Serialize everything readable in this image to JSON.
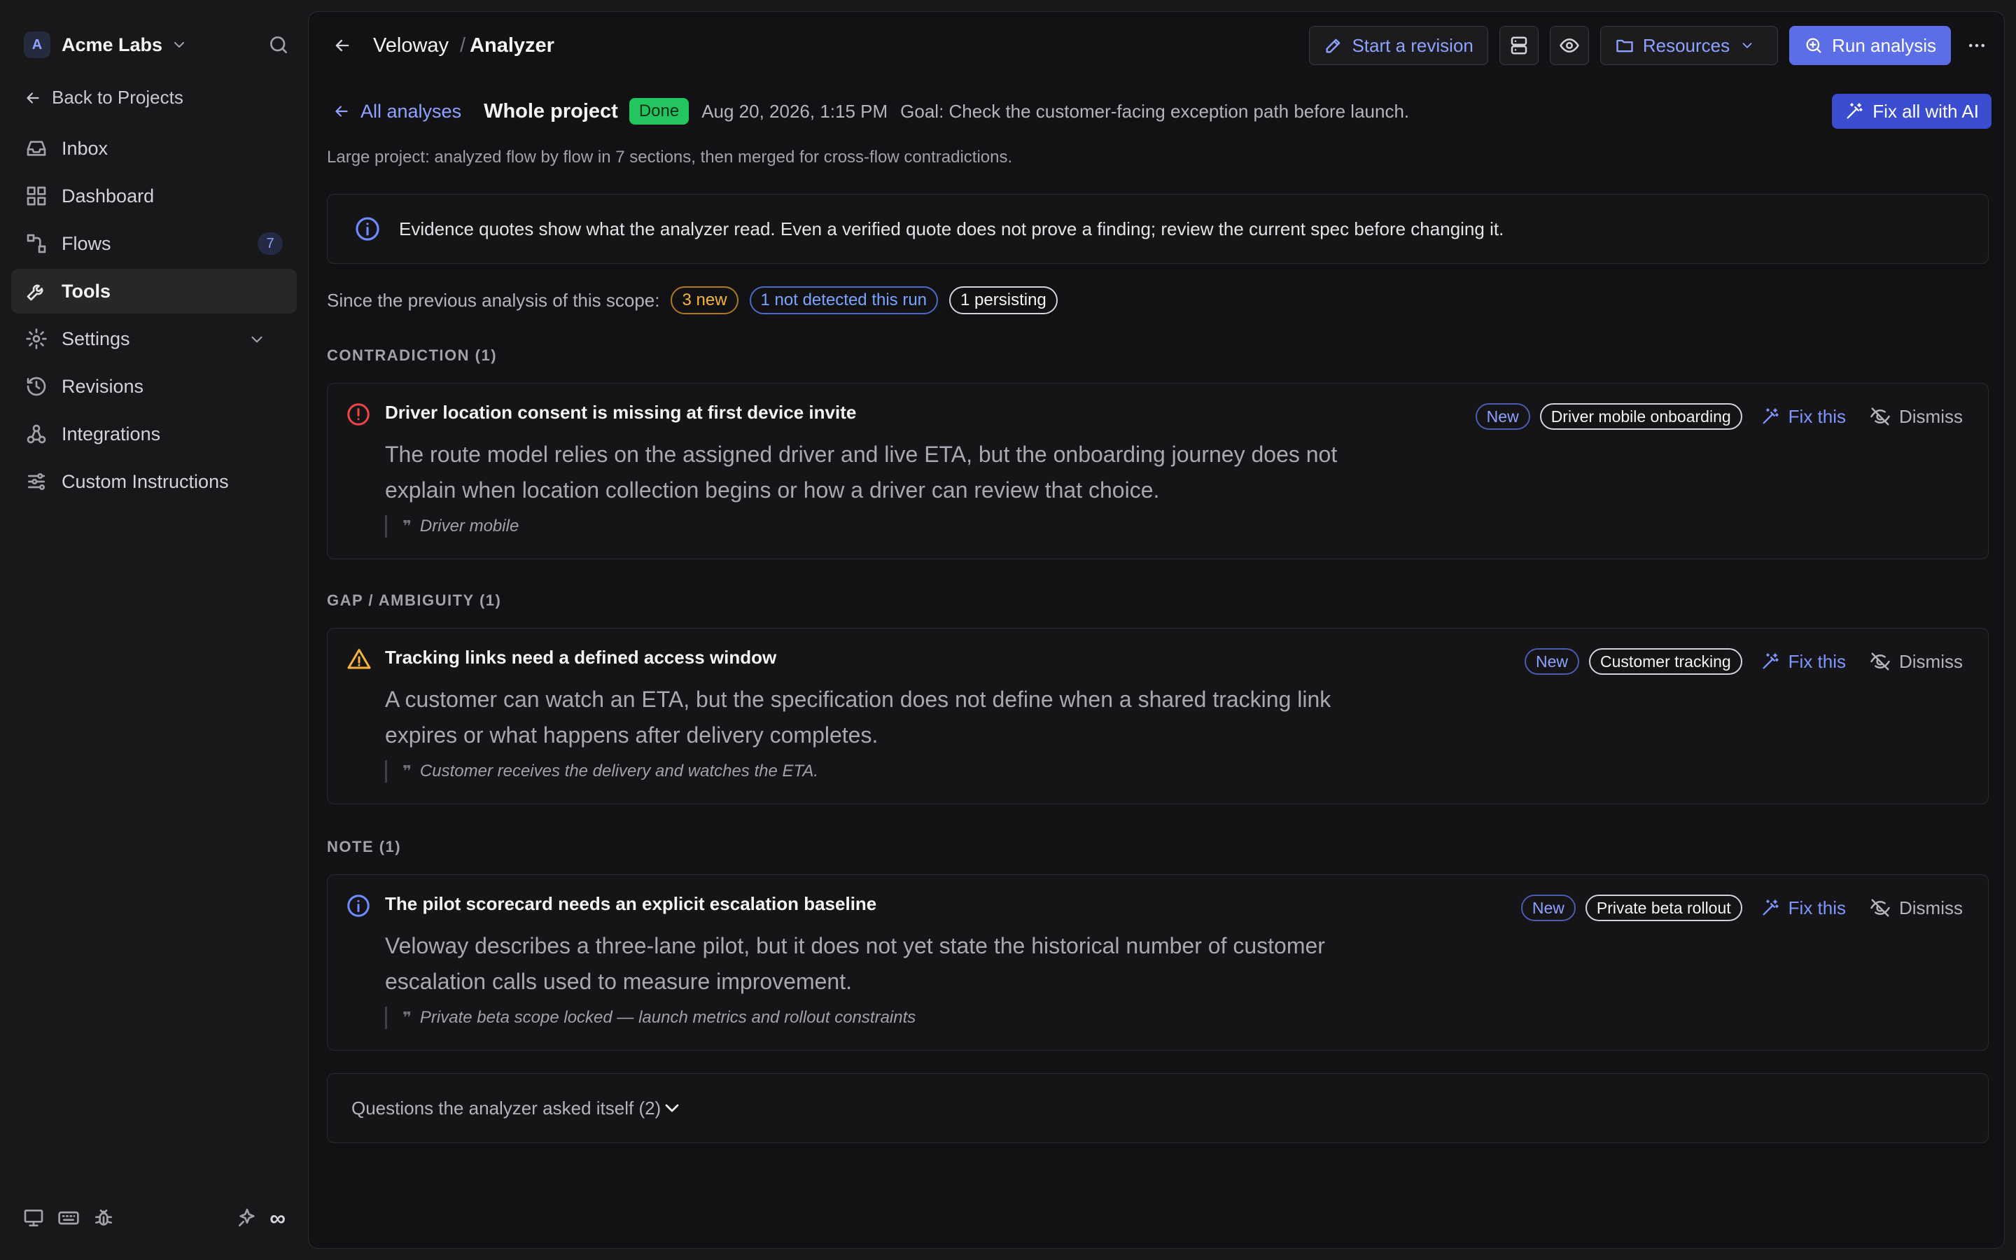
{
  "sidebar": {
    "org_initial": "A",
    "org_name": "Acme Labs",
    "back_label": "Back to Projects",
    "items": [
      {
        "label": "Inbox",
        "icon": "inbox-icon"
      },
      {
        "label": "Dashboard",
        "icon": "dashboard-icon"
      },
      {
        "label": "Flows",
        "icon": "flows-icon",
        "badge": "7"
      },
      {
        "label": "Tools",
        "icon": "wrench-icon",
        "active": true
      },
      {
        "label": "Settings",
        "icon": "gear-icon"
      },
      {
        "label": "Revisions",
        "icon": "history-icon"
      },
      {
        "label": "Integrations",
        "icon": "webhook-icon"
      },
      {
        "label": "Custom Instructions",
        "icon": "sliders-icon"
      }
    ],
    "footer_infinity": "∞"
  },
  "header": {
    "project": "Veloway",
    "separator": "/",
    "page": "Analyzer",
    "start_revision": "Start a revision",
    "resources": "Resources",
    "run_analysis": "Run analysis"
  },
  "analysis": {
    "all_analyses": "All analyses",
    "scope": "Whole project",
    "status": "Done",
    "date": "Aug 20, 2026, 1:15 PM",
    "goal": "Goal: Check the customer-facing exception path before launch.",
    "fix_all": "Fix all with AI",
    "note": "Large project: analyzed flow by flow in 7 sections, then merged for cross-flow contradictions.",
    "banner": "Evidence quotes show what the analyzer read. Even a verified quote does not prove a finding; review the current spec before changing it.",
    "since_label": "Since the previous analysis of this scope:",
    "pill_new": "3 new",
    "pill_not_detected": "1 not detected this run",
    "pill_persisting": "1 persisting"
  },
  "sections": [
    {
      "heading": "CONTRADICTION (1)",
      "title": "Driver location consent is missing at first device invite",
      "body": "The route model relies on the assigned driver and live ETA, but the onboarding journey does not explain when location collection begins or how a driver can review that choice.",
      "quote": "Driver mobile",
      "tag_new": "New",
      "flow": "Driver mobile onboarding",
      "severity_color": "#ef4444"
    },
    {
      "heading": "GAP / AMBIGUITY (1)",
      "title": "Tracking links need a defined access window",
      "body": "A customer can watch an ETA, but the specification does not define when a shared tracking link expires or what happens after delivery completes.",
      "quote": "Customer receives the delivery and watches the ETA.",
      "tag_new": "New",
      "flow": "Customer tracking",
      "severity_color": "#f5b43c"
    },
    {
      "heading": "NOTE (1)",
      "title": "The pilot scorecard needs an explicit escalation baseline",
      "body": "Veloway describes a three-lane pilot, but it does not yet state the historical number of customer escalation calls used to measure improvement.",
      "quote": "Private beta scope locked — launch metrics and rollout constraints",
      "tag_new": "New",
      "flow": "Private beta rollout",
      "severity_color": "#6f8cff"
    }
  ],
  "actions": {
    "fix": "Fix this",
    "dismiss": "Dismiss"
  },
  "questions": "Questions the analyzer asked itself (2)"
}
